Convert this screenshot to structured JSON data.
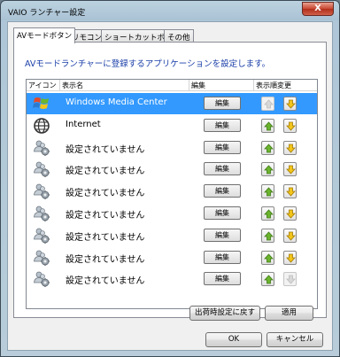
{
  "window": {
    "title": "VAIO ランチャー設定",
    "close_label": "X"
  },
  "tabs": [
    {
      "label": "AVモードボタン",
      "active": true
    },
    {
      "label": "リモコン",
      "active": false
    },
    {
      "label": "ショートカットボタン",
      "active": false
    },
    {
      "label": "その他",
      "active": false
    }
  ],
  "instruction": "AVモードランチャーに登録するアプリケーションを設定します。",
  "columns": {
    "icon": "アイコン",
    "name": "表示名",
    "edit": "編集",
    "order": "表示順変更"
  },
  "rows": [
    {
      "icon": "windows-logo-icon",
      "name": "Windows Media Center",
      "edit": "編集",
      "selected": true,
      "up_enabled": false,
      "down_enabled": true
    },
    {
      "icon": "globe-icon",
      "name": "Internet",
      "edit": "編集",
      "selected": false,
      "up_enabled": true,
      "down_enabled": true
    },
    {
      "icon": "users-gear-icon",
      "name": "設定されていません",
      "edit": "編集",
      "selected": false,
      "up_enabled": true,
      "down_enabled": true
    },
    {
      "icon": "users-gear-icon",
      "name": "設定されていません",
      "edit": "編集",
      "selected": false,
      "up_enabled": true,
      "down_enabled": true
    },
    {
      "icon": "users-gear-icon",
      "name": "設定されていません",
      "edit": "編集",
      "selected": false,
      "up_enabled": true,
      "down_enabled": true
    },
    {
      "icon": "users-gear-icon",
      "name": "設定されていません",
      "edit": "編集",
      "selected": false,
      "up_enabled": true,
      "down_enabled": true
    },
    {
      "icon": "users-gear-icon",
      "name": "設定されていません",
      "edit": "編集",
      "selected": false,
      "up_enabled": true,
      "down_enabled": true
    },
    {
      "icon": "users-gear-icon",
      "name": "設定されていません",
      "edit": "編集",
      "selected": false,
      "up_enabled": true,
      "down_enabled": true
    },
    {
      "icon": "users-gear-icon",
      "name": "設定されていません",
      "edit": "編集",
      "selected": false,
      "up_enabled": true,
      "down_enabled": false
    }
  ],
  "buttons": {
    "reset": "出荷時設定に戻す",
    "apply": "適用",
    "ok": "OK",
    "cancel": "キャンセル"
  },
  "colors": {
    "selection": "#3399ff",
    "instruction": "#1a3ea8",
    "arrow_green": "#6bb52e",
    "arrow_yellow": "#f2c51b"
  }
}
